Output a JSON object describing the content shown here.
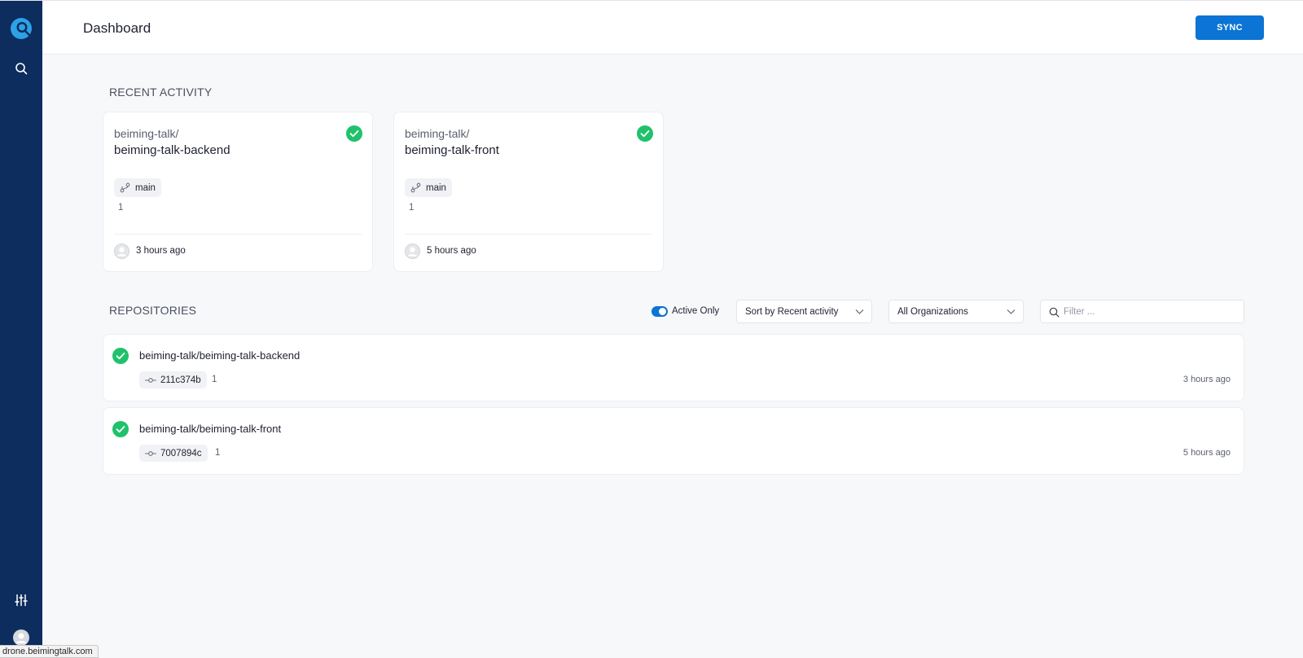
{
  "header": {
    "title": "Dashboard",
    "sync_label": "SYNC"
  },
  "sidebar": {
    "icons": [
      "drone-logo-icon",
      "search-icon",
      "sliders-icon",
      "user-avatar-icon"
    ]
  },
  "recent_activity": {
    "title": "RECENT ACTIVITY",
    "cards": [
      {
        "namespace": "beiming-talk/",
        "name": "beiming-talk-backend",
        "branch": "main",
        "build": "1",
        "time": "3 hours ago"
      },
      {
        "namespace": "beiming-talk/",
        "name": "beiming-talk-front",
        "branch": "main",
        "build": "1",
        "time": "5 hours ago"
      }
    ]
  },
  "repositories": {
    "title": "REPOSITORIES",
    "active_only_label": "Active Only",
    "sort_selected": "Sort by Recent activity",
    "org_selected": "All Organizations",
    "filter_placeholder": "Filter ...",
    "items": [
      {
        "name": "beiming-talk/beiming-talk-backend",
        "commit": "211c374b",
        "build": "1",
        "time": "3 hours ago"
      },
      {
        "name": "beiming-talk/beiming-talk-front",
        "commit": "7007894c",
        "build": "1",
        "time": "5 hours ago"
      }
    ]
  },
  "statusbar": {
    "url": "drone.beimingtalk.com"
  },
  "colors": {
    "sidebar": "#0c2d5e",
    "accent": "#0b74d4",
    "success": "#1fc26b",
    "background": "#f7f8fa"
  }
}
